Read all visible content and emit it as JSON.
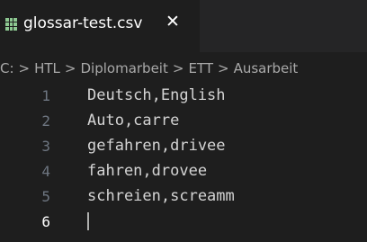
{
  "tab": {
    "icon": "csv-table-icon",
    "filename": "glossar-test.csv",
    "close_glyph": "✕"
  },
  "breadcrumb": {
    "separator": ">",
    "items": [
      "C:",
      "HTL",
      "Diplomarbeit",
      "ETT",
      "Ausarbeit"
    ]
  },
  "editor": {
    "active_line": 6,
    "lines": [
      {
        "number": "1",
        "text": "Deutsch,English"
      },
      {
        "number": "2",
        "text": "Auto,carre"
      },
      {
        "number": "3",
        "text": "gefahren,drivee"
      },
      {
        "number": "4",
        "text": "fahren,drovee"
      },
      {
        "number": "5",
        "text": "schreien,screamm"
      },
      {
        "number": "6",
        "text": ""
      }
    ]
  },
  "colors": {
    "background": "#1e1e1e",
    "tabbar": "#252526",
    "file_icon": "#8dc891",
    "line_number": "#6e7681",
    "active_line_number": "#ffffff"
  }
}
